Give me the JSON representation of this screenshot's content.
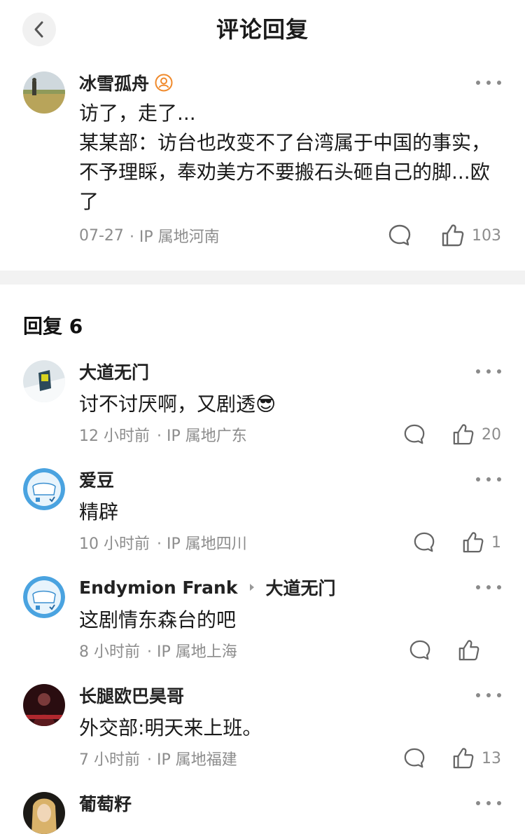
{
  "header": {
    "title": "评论回复"
  },
  "main_comment": {
    "author": "冰雪孤舟",
    "text_line1": "访了，走了...",
    "text_rest": "某某部：访台也改变不了台湾属于中国的事实，不予理睬，奉劝美方不要搬石头砸自己的脚...欧了",
    "date": "07-27",
    "ip": "· IP 属地河南",
    "likes": "103"
  },
  "replies_header": "回复 6",
  "replies": [
    {
      "author": "大道无门",
      "text": "讨不讨厌啊，又剧透😎",
      "time": "12 小时前",
      "ip": "· IP 属地广东",
      "likes": "20"
    },
    {
      "author": "爱豆",
      "text": "精辟",
      "time": "10 小时前",
      "ip": "· IP 属地四川",
      "likes": "1"
    },
    {
      "author": "Endymion Frank",
      "reply_to": "大道无门",
      "text": "这剧情东森台的吧",
      "time": "8 小时前",
      "ip": "· IP 属地上海",
      "likes": ""
    },
    {
      "author": "长腿欧巴昊哥",
      "text": "外交部:明天来上班。",
      "time": "7 小时前",
      "ip": "· IP 属地福建",
      "likes": "13"
    },
    {
      "author": "葡萄籽"
    }
  ]
}
